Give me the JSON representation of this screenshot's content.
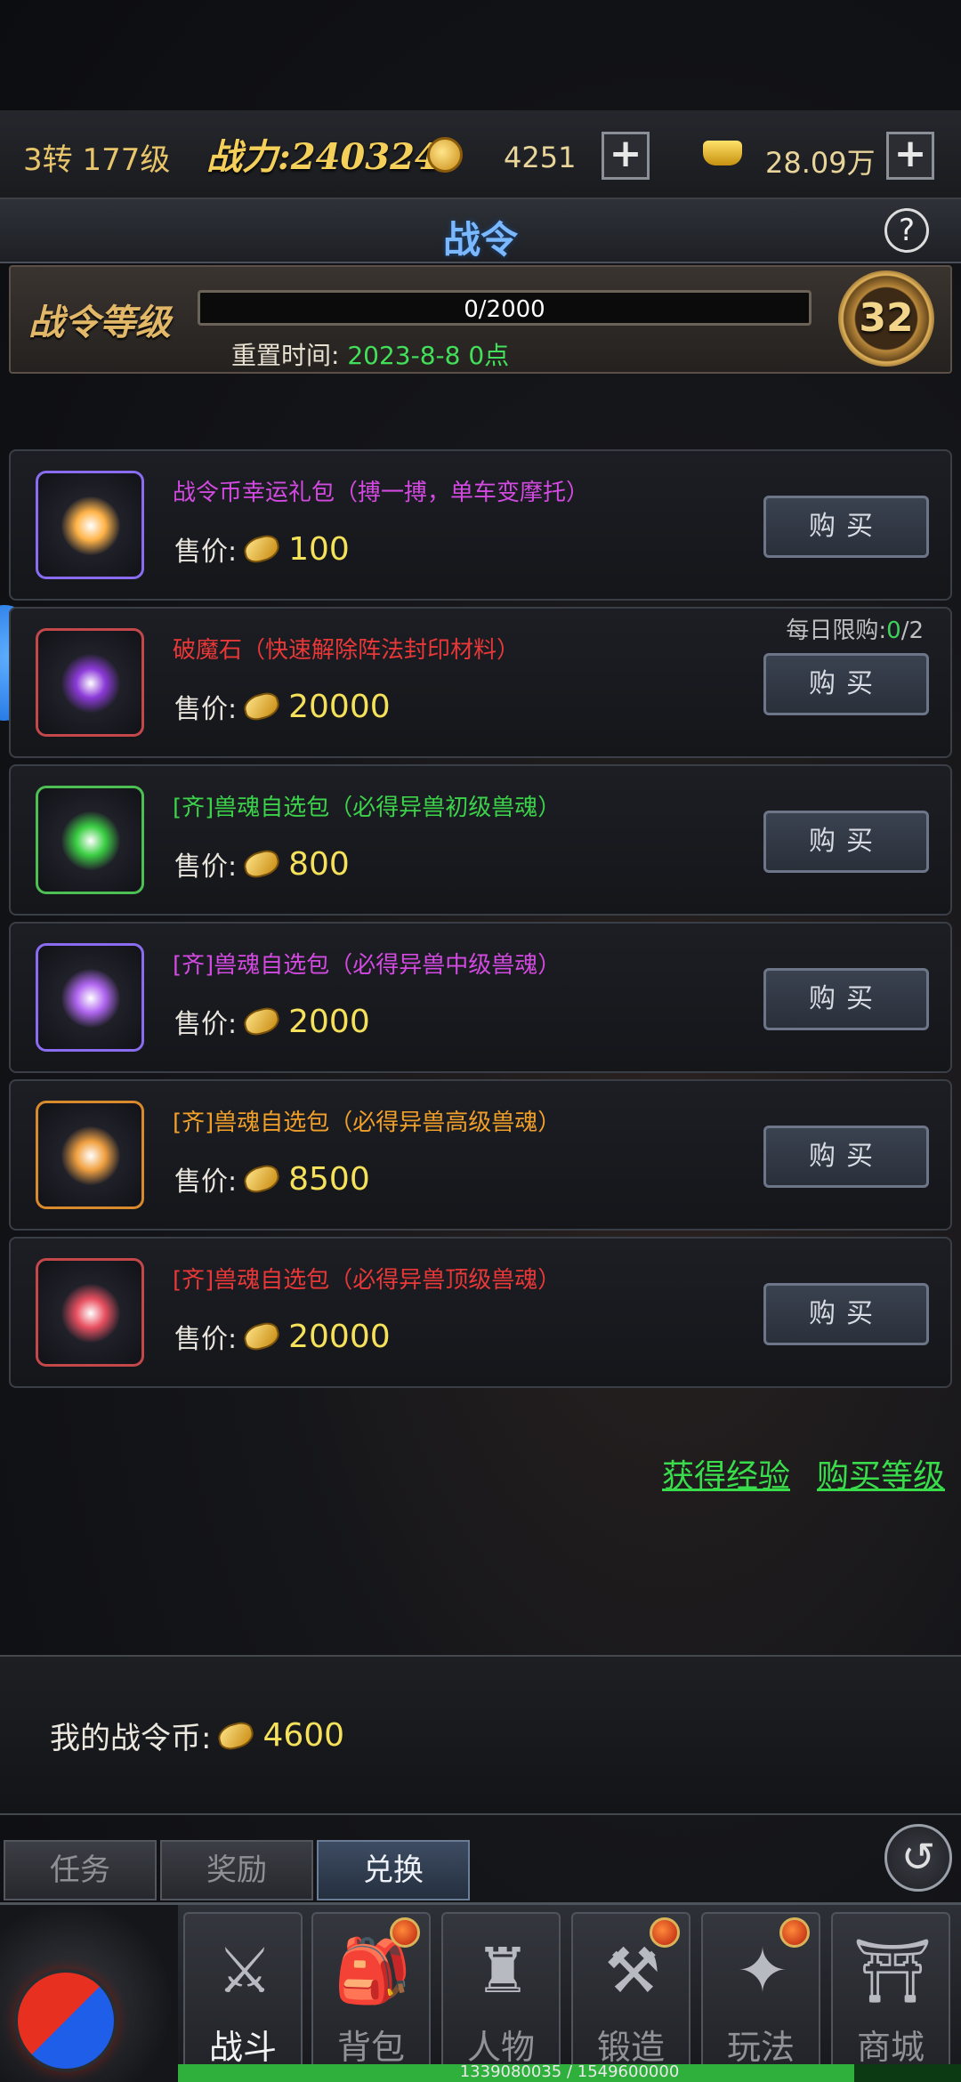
{
  "topbar": {
    "level": "3转 177级",
    "power": "战力:240324",
    "coin_value": "4251",
    "ingot_value": "28.09万",
    "plus_label": "+"
  },
  "title": {
    "text": "战令",
    "help_label": "?"
  },
  "level_panel": {
    "label": "战令等级",
    "progress_text": "0/2000",
    "progress_fraction": 0,
    "reset_label": "重置时间:",
    "reset_date": "2023-8-8 0点",
    "badge_level": "32"
  },
  "items": [
    {
      "name": "战令币幸运礼包（搏一搏，单车变摩托）",
      "name_color": "#d24ae0",
      "border_color": "#8a6cf0",
      "icon_color": "#ffb347",
      "price": "100",
      "limit": null
    },
    {
      "name": "破魔石（快速解除阵法封印材料）",
      "name_color": "#e83838",
      "border_color": "#c4484a",
      "icon_color": "#8c3ad8",
      "price": "20000",
      "limit": {
        "label": "每日限购:",
        "used": "0",
        "total": "/2"
      }
    },
    {
      "name": "[齐]兽魂自选包（必得异兽初级兽魂）",
      "name_color": "#3cd24a",
      "border_color": "#4cc052",
      "icon_color": "#3ccf44",
      "price": "800",
      "limit": null
    },
    {
      "name": "[齐]兽魂自选包（必得异兽中级兽魂）",
      "name_color": "#d24ae0",
      "border_color": "#8a6cf0",
      "icon_color": "#b066f0",
      "price": "2000",
      "limit": null
    },
    {
      "name": "[齐]兽魂自选包（必得异兽高级兽魂）",
      "name_color": "#f0a02a",
      "border_color": "#d88a2c",
      "icon_color": "#f0a040",
      "price": "8500",
      "limit": null
    },
    {
      "name": "[齐]兽魂自选包（必得异兽顶级兽魂）",
      "name_color": "#e83838",
      "border_color": "#c4484a",
      "icon_color": "#e85060",
      "price": "20000",
      "limit": null
    }
  ],
  "price_label": "售价:",
  "buy_label": "购买",
  "links": {
    "get_exp": "获得经验",
    "buy_level": "购买等级"
  },
  "my_coin": {
    "label": "我的战令币:",
    "value": "4600"
  },
  "tabs": [
    "任务",
    "奖励",
    "兑换"
  ],
  "nav": {
    "items": [
      {
        "label": "战斗",
        "glyph": "⚔"
      },
      {
        "label": "背包",
        "glyph": "🎒"
      },
      {
        "label": "人物",
        "glyph": "♜"
      },
      {
        "label": "锻造",
        "glyph": "⚒"
      },
      {
        "label": "玩法",
        "glyph": "✦"
      },
      {
        "label": "商城",
        "glyph": "⛩"
      }
    ]
  },
  "exp_bar": {
    "text": "1339080035 / 1549600000",
    "fraction": 0.864
  }
}
